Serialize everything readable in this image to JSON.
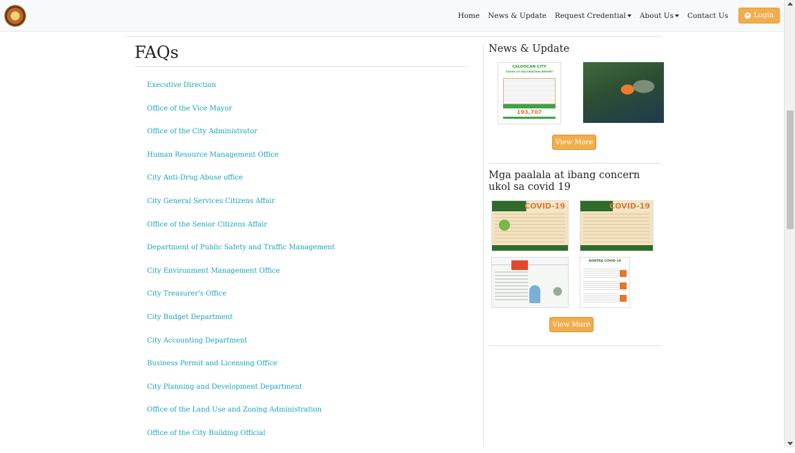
{
  "nav": {
    "items": [
      {
        "label": "Home",
        "dropdown": false
      },
      {
        "label": "News & Update",
        "dropdown": false
      },
      {
        "label": "Request Credential",
        "dropdown": true
      },
      {
        "label": "About Us",
        "dropdown": true
      },
      {
        "label": "Contact Us",
        "dropdown": false
      }
    ],
    "login_label": "Login",
    "accent": "#f0ad4e"
  },
  "faq": {
    "title": "FAQs",
    "items": [
      "Executive Direction",
      "Office of the Vice Mayor",
      "Office of the City Administrator",
      "Human Resource Management Office",
      "City Anti-Drug Abuse office",
      "City General Services Citizens Affair",
      "Office of the Senior Citizens Affair",
      "Department of Public Safety and Traffic Management",
      "City Environment Management Office",
      "City Treasurer's Office",
      "City Budget Department",
      "City Accounting Department",
      "Business Permit and Licensing Office",
      "City Planning and Development Department",
      "Office of the Land Use and Zoning Administration",
      "Office of the City Building Official"
    ],
    "link_color": "#17a2b8"
  },
  "news": {
    "title": "News & Update",
    "view_more": "View More",
    "vaccine_card": {
      "title": "CALOOCAN CITY",
      "subtitle": "COVID-19 VACCINATION REPORT",
      "total": "193,707"
    }
  },
  "reminders": {
    "title": "Mga paalala at ibang concern ukol sa covid 19",
    "view_more": "View More",
    "posters": {
      "covid_title": "COVID-19",
      "kontra_title": "KONTRA COVID-19"
    }
  }
}
